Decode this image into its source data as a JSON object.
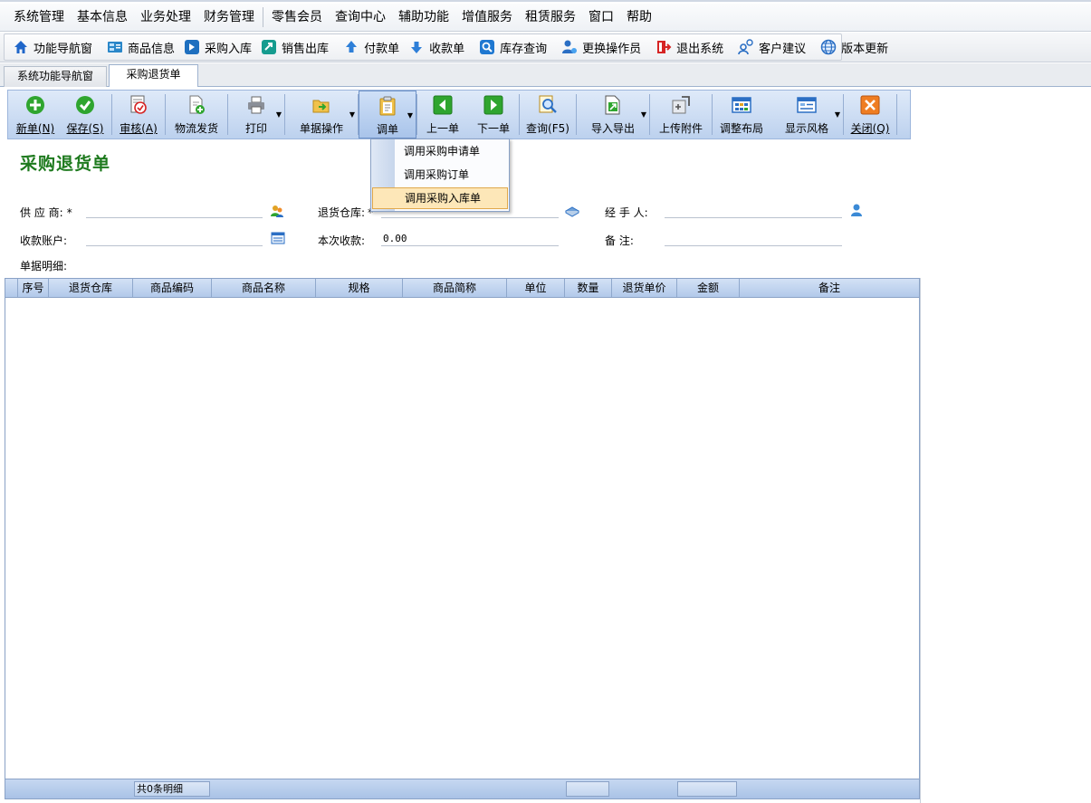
{
  "menu": {
    "items": [
      "系统管理",
      "基本信息",
      "业务处理",
      "财务管理",
      "零售会员",
      "查询中心",
      "辅助功能",
      "增值服务",
      "租赁服务",
      "窗口",
      "帮助"
    ]
  },
  "quickbar": {
    "nav": "功能导航窗",
    "goods": "商品信息",
    "purchase_in": "采购入库",
    "sales_out": "销售出库",
    "payment": "付款单",
    "receipt": "收款单",
    "stock_query": "库存查询",
    "change_operator": "更换操作员",
    "exit": "退出系统",
    "feedback": "客户建议",
    "update": "版本更新"
  },
  "tabs": {
    "nav": "系统功能导航窗",
    "current": "采购退货单"
  },
  "ribbon": {
    "new": "新单(N)",
    "save": "保存(S)",
    "audit": "审核(A)",
    "logistics": "物流发货",
    "print": "打印",
    "bill_ops": "单据操作",
    "call_bill": "调单",
    "prev": "上一单",
    "next": "下一单",
    "query": "查询(F5)",
    "import_export": "导入导出",
    "upload": "上传附件",
    "layout": "调整布局",
    "style": "显示风格",
    "close": "关闭(Q)"
  },
  "dropdown": {
    "item1": "调用采购申请单",
    "item2": "调用采购订单",
    "item3": "调用采购入库单"
  },
  "form": {
    "title": "采购退货单",
    "supplier_label": "供 应 商:",
    "warehouse_label": "退货仓库:",
    "handler_label": "经 手 人:",
    "account_label": "收款账户:",
    "amount_label": "本次收款:",
    "amount_value": "0.00",
    "remark_label": "备    注:",
    "detail_label": "单据明细:",
    "required_mark": "*"
  },
  "grid": {
    "columns": [
      "序号",
      "退货仓库",
      "商品编码",
      "商品名称",
      "规格",
      "商品简称",
      "单位",
      "数量",
      "退货单价",
      "金额",
      "备注"
    ],
    "footer_count": "共0条明细"
  }
}
